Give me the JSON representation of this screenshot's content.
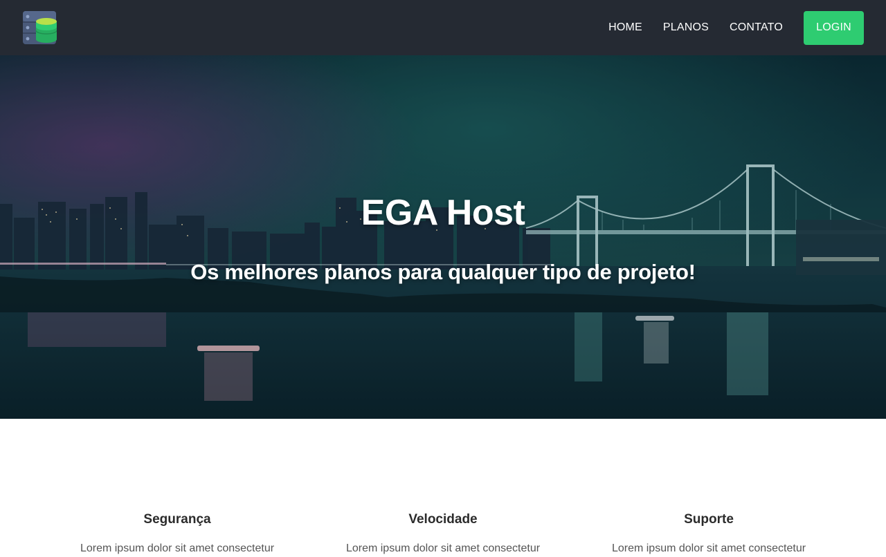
{
  "header": {
    "logo_icon": "server-database-icon",
    "nav": [
      {
        "label": "HOME"
      },
      {
        "label": "PLANOS"
      },
      {
        "label": "CONTATO"
      }
    ],
    "login_label": "LOGIN"
  },
  "hero": {
    "background": "night-city-bridge-photo",
    "title": "EGA Host",
    "subtitle": "Os melhores planos para qualquer tipo de projeto!"
  },
  "features": [
    {
      "title": "Segurança",
      "text": "Lorem ipsum dolor sit amet consectetur"
    },
    {
      "title": "Velocidade",
      "text": "Lorem ipsum dolor sit amet consectetur"
    },
    {
      "title": "Suporte",
      "text": "Lorem ipsum dolor sit amet consectetur"
    }
  ],
  "colors": {
    "navbar_bg": "#252a33",
    "accent_green": "#2ecc71",
    "text_dark": "#2b2b2b"
  }
}
